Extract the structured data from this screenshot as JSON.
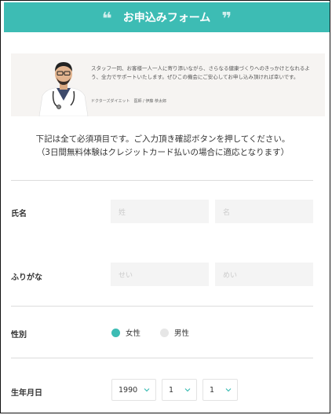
{
  "header": {
    "title": "お申込みフォーム",
    "quote_open": "❝",
    "quote_close": "❞"
  },
  "intro": {
    "text": "スタッフ一同、お客様一人一人に寄り添いながら、さらなる健康づくりへのきっかけとなれるよう、全力でサポートいたします。ぜひこの機会にご安心してお申し込み頂ければ幸いです。",
    "caption": "ドクターズダイエット　医師 / 伊藤 恭太郎"
  },
  "notice": {
    "line1": "下記は全て必須項目です。ご入力頂き確認ボタンを押してください。",
    "line2": "（3日間無料体験はクレジットカード払いの場合に適応となります）"
  },
  "form": {
    "name": {
      "label": "氏名",
      "last_placeholder": "姓",
      "first_placeholder": "名"
    },
    "furigana": {
      "label": "ふりがな",
      "last_placeholder": "せい",
      "first_placeholder": "めい"
    },
    "gender": {
      "label": "性別",
      "options": [
        {
          "label": "女性",
          "selected": true
        },
        {
          "label": "男性",
          "selected": false
        }
      ]
    },
    "birthday": {
      "label": "生年月日",
      "year": "1990",
      "month": "1",
      "day": "1"
    }
  },
  "colors": {
    "accent": "#3dbcb4",
    "field_bg": "#f4f4f4",
    "intro_bg": "#f6f4f2"
  }
}
